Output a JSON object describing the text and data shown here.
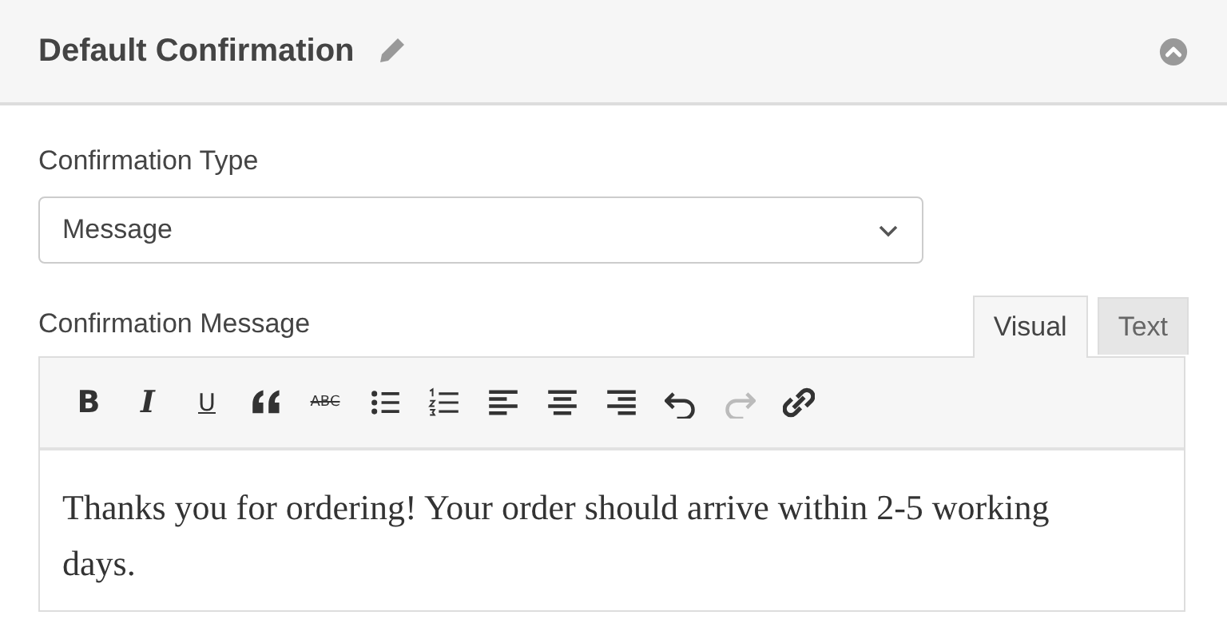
{
  "header": {
    "title": "Default Confirmation",
    "expanded": true
  },
  "confirmation_type": {
    "label": "Confirmation Type",
    "value": "Message"
  },
  "confirmation_message": {
    "label": "Confirmation Message",
    "tabs": [
      {
        "label": "Visual",
        "selected": true
      },
      {
        "label": "Text",
        "selected": false
      }
    ],
    "toolbar": [
      {
        "kind": "bold",
        "label": "B",
        "disabled": false
      },
      {
        "kind": "italic",
        "label": "I",
        "disabled": false
      },
      {
        "kind": "underline",
        "label": "U",
        "disabled": false
      },
      {
        "kind": "quote",
        "disabled": false
      },
      {
        "kind": "strike",
        "label": "ABC",
        "disabled": false
      },
      {
        "kind": "bullets",
        "disabled": false
      },
      {
        "kind": "numbers",
        "disabled": false
      },
      {
        "kind": "align-left",
        "disabled": false
      },
      {
        "kind": "align-center",
        "disabled": false
      },
      {
        "kind": "align-right",
        "disabled": false
      },
      {
        "kind": "undo",
        "disabled": false
      },
      {
        "kind": "redo",
        "disabled": true
      },
      {
        "kind": "link",
        "disabled": false
      }
    ],
    "content": "Thanks you for ordering! Your order should arrive within 2-5 working days."
  }
}
